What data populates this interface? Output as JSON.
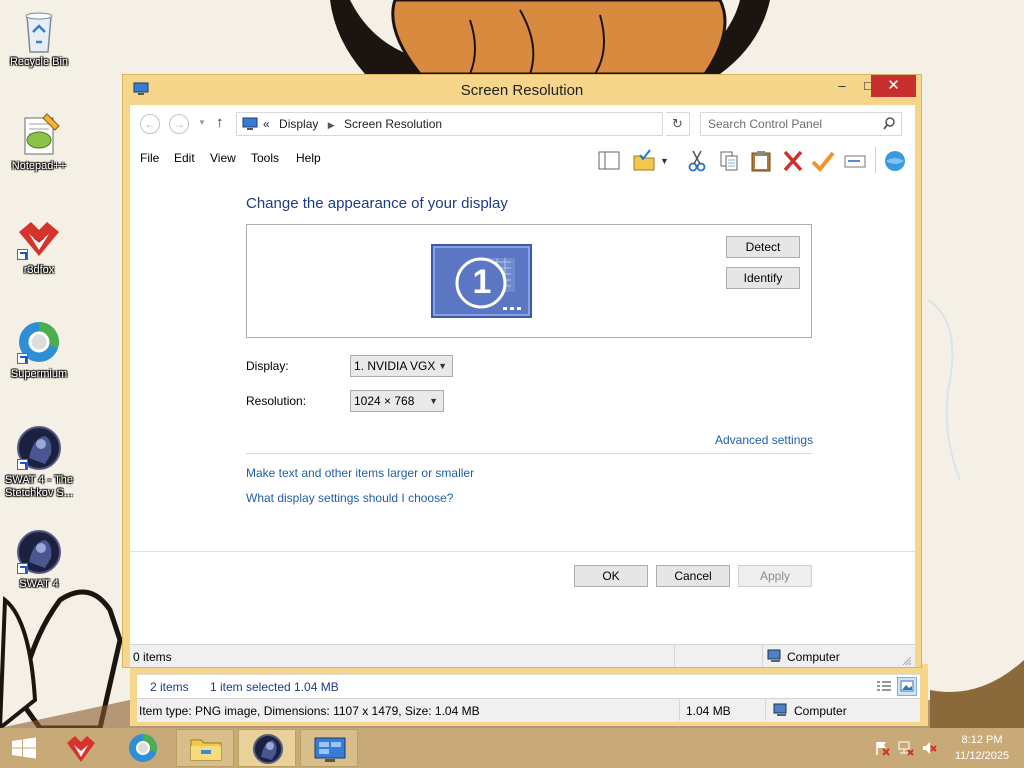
{
  "desktop": {
    "icons": [
      {
        "label": "Recycle Bin",
        "icon": "recycle-bin-icon"
      },
      {
        "label": "Notepad++",
        "icon": "notepad-plus-plus-icon"
      },
      {
        "label": "r3dfox",
        "icon": "r3dfox-icon"
      },
      {
        "label": "Supermium",
        "icon": "supermium-icon"
      },
      {
        "label": "SWAT 4 - The Stetchkov S...",
        "icon": "swat4-stetchkov-icon"
      },
      {
        "label": "SWAT 4",
        "icon": "swat4-icon"
      }
    ]
  },
  "window": {
    "title": "Screen Resolution",
    "controls": {
      "minimize": "–",
      "maximize": "□",
      "close": "✕"
    }
  },
  "nav": {
    "breadcrumb_prefix": "«",
    "breadcrumb": [
      "Display",
      "Screen Resolution"
    ],
    "search_placeholder": "Search Control Panel"
  },
  "menu": [
    "File",
    "Edit",
    "View",
    "Tools",
    "Help"
  ],
  "toolbar": [
    "layout-icon",
    "folder-check-icon",
    "cut-icon",
    "copy-icon",
    "paste-icon",
    "delete-icon",
    "checkmark-icon",
    "rename-icon",
    "globe-icon"
  ],
  "content": {
    "heading": "Change the appearance of your display",
    "monitor_number": "1",
    "detect": "Detect",
    "identify": "Identify",
    "display_label": "Display:",
    "display_value": "1. NVIDIA VGX",
    "resolution_label": "Resolution:",
    "resolution_value": "1024 × 768",
    "advanced": "Advanced settings",
    "larger_link": "Make text and other items larger or smaller",
    "which_link": "What display settings should I choose?",
    "ok": "OK",
    "cancel": "Cancel",
    "apply": "Apply"
  },
  "statusbar": {
    "items": "0 items",
    "location": "Computer"
  },
  "background_window": {
    "item_count": "2 items",
    "selected": "1 item selected  1.04 MB",
    "details": "Item type: PNG image, Dimensions: 1107 x 1479, Size: 1.04 MB",
    "size": "1.04 MB",
    "location": "Computer"
  },
  "taskbar": {
    "apps": [
      "start-button",
      "r3dfox-icon",
      "supermium-icon",
      "file-explorer-icon",
      "swat4-icon",
      "control-panel-icon"
    ],
    "time": "8:12 PM",
    "date": "11/12/2025"
  }
}
